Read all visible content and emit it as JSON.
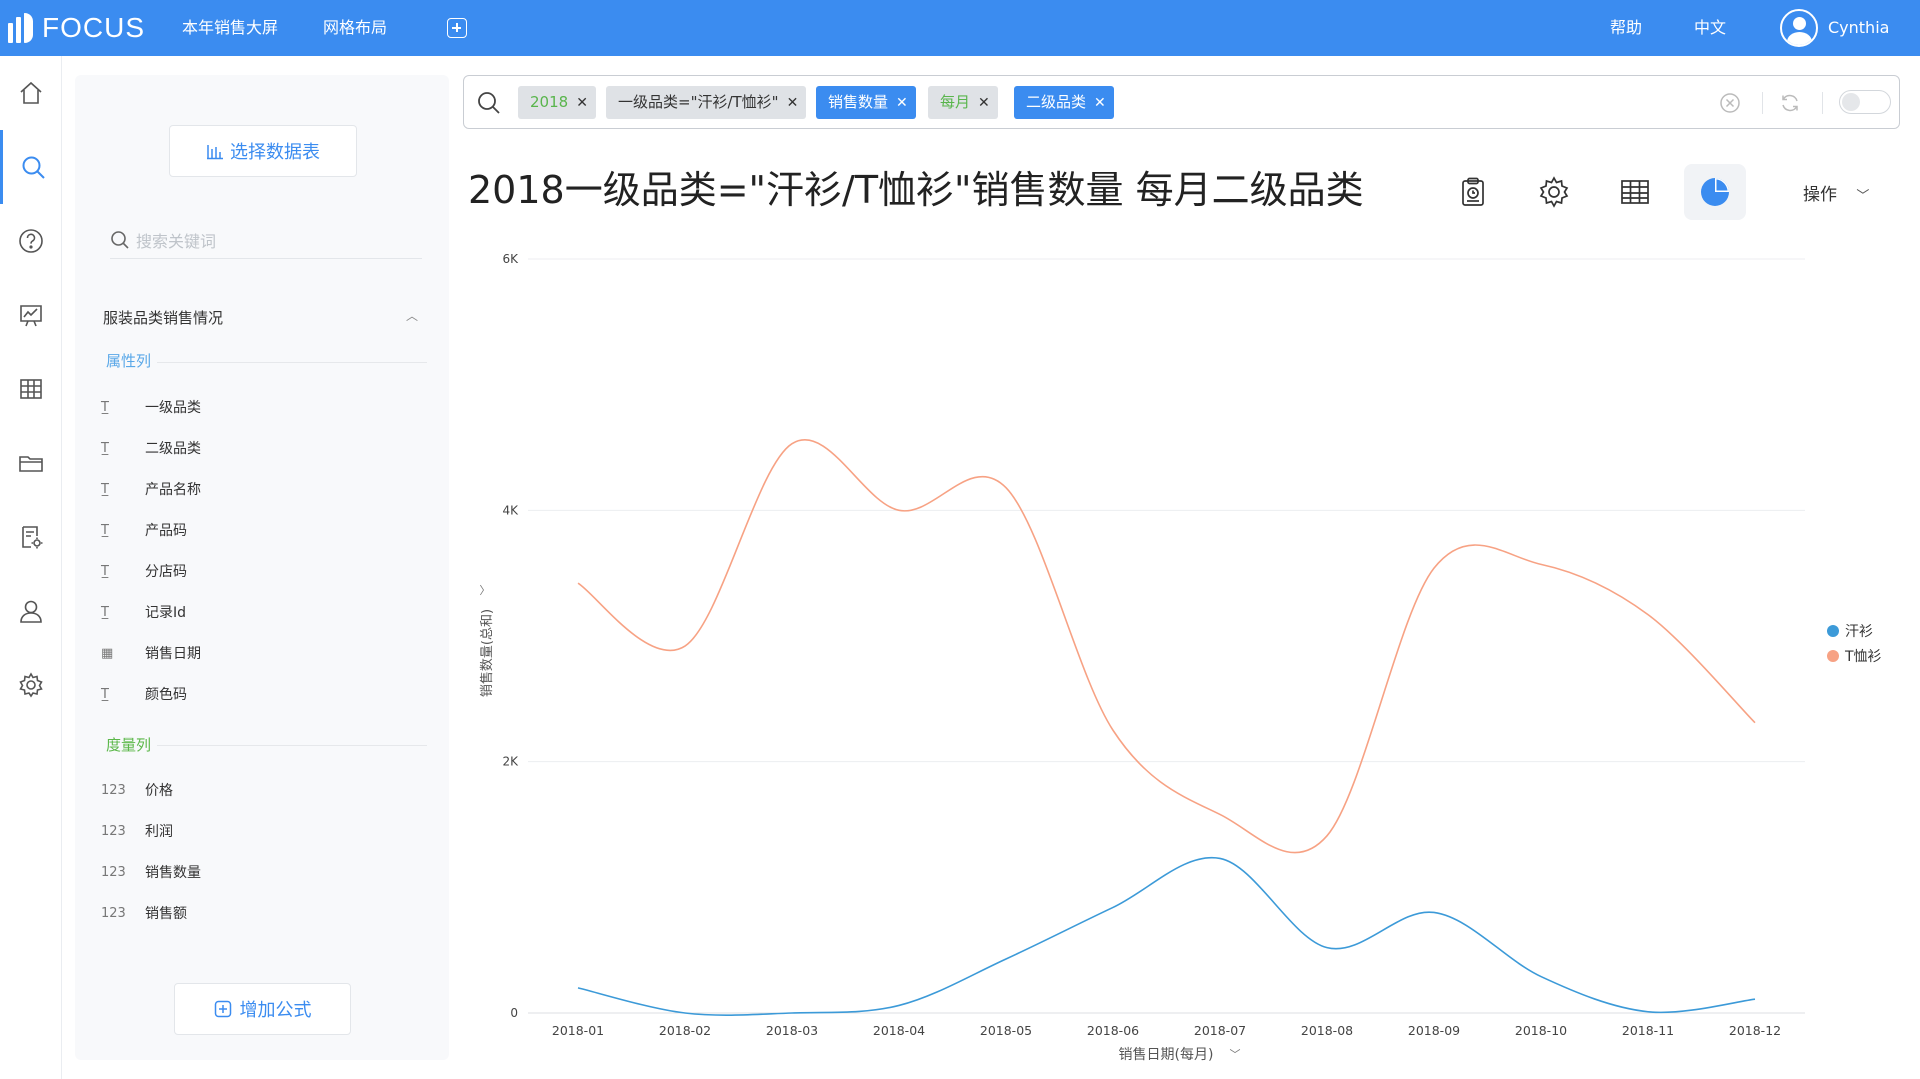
{
  "app": {
    "logo": "FOCUS",
    "nav": [
      "本年销售大屏",
      "网格布局"
    ],
    "help": "帮助",
    "language": "中文",
    "user": "Cynthia"
  },
  "sidebar_icons": [
    "home-icon",
    "search-icon",
    "help-icon",
    "board-icon",
    "table-icon",
    "folder-icon",
    "data-settings-icon",
    "user-icon",
    "gear-icon"
  ],
  "panel": {
    "select_table": "选择数据表",
    "search_placeholder": "搜索关键词",
    "group_title": "服装品类销售情况",
    "attr_section": "属性列",
    "measure_section": "度量列",
    "attributes": [
      {
        "label": "一级品类",
        "icon": "text-type-icon"
      },
      {
        "label": "二级品类",
        "icon": "text-type-icon"
      },
      {
        "label": "产品名称",
        "icon": "text-type-icon"
      },
      {
        "label": "产品码",
        "icon": "text-type-icon"
      },
      {
        "label": "分店码",
        "icon": "text-type-icon"
      },
      {
        "label": "记录Id",
        "icon": "text-type-icon"
      },
      {
        "label": "销售日期",
        "icon": "calendar-icon"
      },
      {
        "label": "颜色码",
        "icon": "text-type-icon"
      }
    ],
    "measures": [
      "价格",
      "利润",
      "销售数量",
      "销售额"
    ],
    "measure_prefix": "123",
    "add_formula": "增加公式"
  },
  "search": {
    "tags": [
      {
        "text": "2018",
        "style": "grey-green"
      },
      {
        "text": "一级品类=\"汗衫/T恤衫\"",
        "style": "grey"
      },
      {
        "text": "销售数量",
        "style": "blue"
      },
      {
        "text": "每月",
        "style": "grey-green"
      },
      {
        "text": "二级品类",
        "style": "blue"
      }
    ]
  },
  "title": "2018一级品类=\"汗衫/T恤衫\"销售数量 每月二级品类",
  "toolbar": {
    "icons": [
      "clipboard-icon",
      "settings-icon",
      "table-view-icon",
      "pie-chart-icon"
    ],
    "ops_label": "操作"
  },
  "colors": {
    "brand": "#3b8cf0",
    "series_1": "#3c9ad8",
    "series_2": "#f7a284"
  },
  "chart_data": {
    "type": "line",
    "x": [
      "2018-01",
      "2018-02",
      "2018-03",
      "2018-04",
      "2018-05",
      "2018-06",
      "2018-07",
      "2018-08",
      "2018-09",
      "2018-10",
      "2018-11",
      "2018-12"
    ],
    "series": [
      {
        "name": "汗衫",
        "values": [
          200,
          0,
          0,
          60,
          430,
          840,
          1230,
          520,
          800,
          290,
          10,
          110
        ]
      },
      {
        "name": "T恤衫",
        "values": [
          3420,
          2920,
          4530,
          4000,
          4180,
          2250,
          1580,
          1410,
          3540,
          3570,
          3170,
          2310
        ]
      }
    ],
    "yticks": [
      "0",
      "2K",
      "4K",
      "6K"
    ],
    "ylim": [
      0,
      6000
    ],
    "xlabel": "销售日期(每月)",
    "ylabel": "销售数量(总和)",
    "grid": true,
    "legend_position": "right"
  }
}
